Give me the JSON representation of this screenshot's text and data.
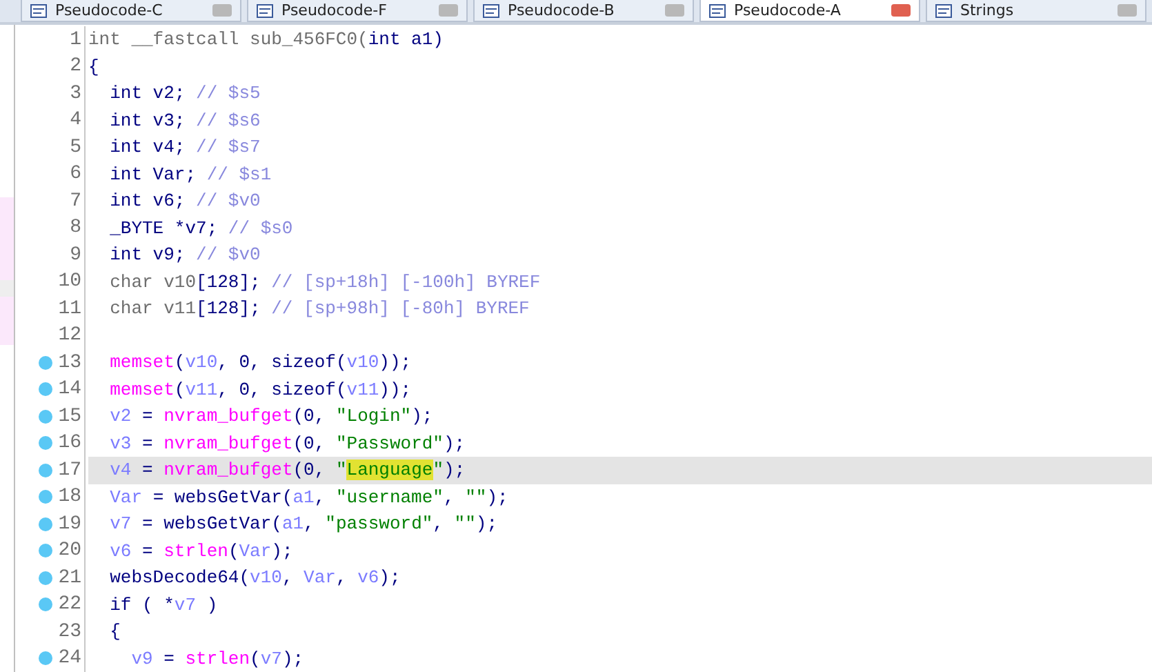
{
  "tabs": [
    {
      "label": "Pseudocode-C",
      "selected": false
    },
    {
      "label": "Pseudocode-F",
      "selected": false
    },
    {
      "label": "Pseudocode-B",
      "selected": false
    },
    {
      "label": "Pseudocode-A",
      "selected": true
    },
    {
      "label": "Strings",
      "selected": false
    }
  ],
  "lines": [
    {
      "number": "1",
      "breakpoint": false,
      "current": false,
      "tokens": [
        {
          "kind": "gray",
          "text": "int __fastcall sub_456FC0("
        },
        {
          "kind": "plain",
          "text": "int a1)"
        }
      ]
    },
    {
      "number": "2",
      "breakpoint": false,
      "current": false,
      "tokens": [
        {
          "kind": "plain",
          "text": "{"
        }
      ]
    },
    {
      "number": "3",
      "breakpoint": false,
      "current": false,
      "tokens": [
        {
          "kind": "plain",
          "text": "  int v2; "
        },
        {
          "kind": "comment",
          "text": "// $s5"
        }
      ]
    },
    {
      "number": "4",
      "breakpoint": false,
      "current": false,
      "tokens": [
        {
          "kind": "plain",
          "text": "  int v3; "
        },
        {
          "kind": "comment",
          "text": "// $s6"
        }
      ]
    },
    {
      "number": "5",
      "breakpoint": false,
      "current": false,
      "tokens": [
        {
          "kind": "plain",
          "text": "  int v4; "
        },
        {
          "kind": "comment",
          "text": "// $s7"
        }
      ]
    },
    {
      "number": "6",
      "breakpoint": false,
      "current": false,
      "tokens": [
        {
          "kind": "plain",
          "text": "  int Var; "
        },
        {
          "kind": "comment",
          "text": "// $s1"
        }
      ]
    },
    {
      "number": "7",
      "breakpoint": false,
      "current": false,
      "tokens": [
        {
          "kind": "plain",
          "text": "  int v6; "
        },
        {
          "kind": "comment",
          "text": "// $v0"
        }
      ]
    },
    {
      "number": "8",
      "breakpoint": false,
      "current": false,
      "tokens": [
        {
          "kind": "plain",
          "text": "  _BYTE *v7; "
        },
        {
          "kind": "comment",
          "text": "// $s0"
        }
      ]
    },
    {
      "number": "9",
      "breakpoint": false,
      "current": false,
      "tokens": [
        {
          "kind": "plain",
          "text": "  int v9; "
        },
        {
          "kind": "comment",
          "text": "// $v0"
        }
      ]
    },
    {
      "number": "10",
      "breakpoint": false,
      "current": false,
      "tokens": [
        {
          "kind": "gray",
          "text": "  char v10"
        },
        {
          "kind": "plain",
          "text": "[128]; "
        },
        {
          "kind": "comment",
          "text": "// [sp+18h] [-100h] BYREF"
        }
      ]
    },
    {
      "number": "11",
      "breakpoint": false,
      "current": false,
      "tokens": [
        {
          "kind": "gray",
          "text": "  char v11"
        },
        {
          "kind": "plain",
          "text": "[128]; "
        },
        {
          "kind": "comment",
          "text": "// [sp+98h] [-80h] BYREF"
        }
      ]
    },
    {
      "number": "12",
      "breakpoint": false,
      "current": false
    },
    {
      "number": "13",
      "breakpoint": true,
      "current": false,
      "tokens": [
        {
          "kind": "import",
          "text": "  memset"
        },
        {
          "kind": "plain",
          "text": "("
        },
        {
          "kind": "var",
          "text": "v10"
        },
        {
          "kind": "plain",
          "text": ", 0, sizeof("
        },
        {
          "kind": "var",
          "text": "v10"
        },
        {
          "kind": "plain",
          "text": "));"
        }
      ]
    },
    {
      "number": "14",
      "breakpoint": true,
      "current": false,
      "tokens": [
        {
          "kind": "import",
          "text": "  memset"
        },
        {
          "kind": "plain",
          "text": "("
        },
        {
          "kind": "var",
          "text": "v11"
        },
        {
          "kind": "plain",
          "text": ", 0, sizeof("
        },
        {
          "kind": "var",
          "text": "v11"
        },
        {
          "kind": "plain",
          "text": "));"
        }
      ]
    },
    {
      "number": "15",
      "breakpoint": true,
      "current": false,
      "tokens": [
        {
          "kind": "var",
          "text": "  v2"
        },
        {
          "kind": "plain",
          "text": " = "
        },
        {
          "kind": "import",
          "text": "nvram_bufget"
        },
        {
          "kind": "plain",
          "text": "(0, "
        },
        {
          "kind": "string",
          "text": "\"Login\""
        },
        {
          "kind": "plain",
          "text": ");"
        }
      ]
    },
    {
      "number": "16",
      "breakpoint": true,
      "current": false,
      "tokens": [
        {
          "kind": "var",
          "text": "  v3"
        },
        {
          "kind": "plain",
          "text": " = "
        },
        {
          "kind": "import",
          "text": "nvram_bufget"
        },
        {
          "kind": "plain",
          "text": "(0, "
        },
        {
          "kind": "string",
          "text": "\"Password\""
        },
        {
          "kind": "plain",
          "text": ");"
        }
      ]
    },
    {
      "number": "17",
      "breakpoint": true,
      "current": true,
      "tokens": [
        {
          "kind": "var",
          "text": "  v4"
        },
        {
          "kind": "plain",
          "text": " = "
        },
        {
          "kind": "import",
          "text": "nvram_bufget"
        },
        {
          "kind": "plain",
          "text": "(0, "
        },
        {
          "kind": "string",
          "text": "\""
        },
        {
          "kind": "hit",
          "text": "Language"
        },
        {
          "kind": "string",
          "text": "\""
        },
        {
          "kind": "plain",
          "text": ");"
        }
      ]
    },
    {
      "number": "18",
      "breakpoint": true,
      "current": false,
      "tokens": [
        {
          "kind": "var",
          "text": "  Var"
        },
        {
          "kind": "plain",
          "text": " = websGetVar("
        },
        {
          "kind": "var",
          "text": "a1"
        },
        {
          "kind": "plain",
          "text": ", "
        },
        {
          "kind": "string",
          "text": "\"username\""
        },
        {
          "kind": "plain",
          "text": ", "
        },
        {
          "kind": "string",
          "text": "\"\""
        },
        {
          "kind": "plain",
          "text": ");"
        }
      ]
    },
    {
      "number": "19",
      "breakpoint": true,
      "current": false,
      "tokens": [
        {
          "kind": "var",
          "text": "  v7"
        },
        {
          "kind": "plain",
          "text": " = websGetVar("
        },
        {
          "kind": "var",
          "text": "a1"
        },
        {
          "kind": "plain",
          "text": ", "
        },
        {
          "kind": "string",
          "text": "\"password\""
        },
        {
          "kind": "plain",
          "text": ", "
        },
        {
          "kind": "string",
          "text": "\"\""
        },
        {
          "kind": "plain",
          "text": ");"
        }
      ]
    },
    {
      "number": "20",
      "breakpoint": true,
      "current": false,
      "tokens": [
        {
          "kind": "var",
          "text": "  v6"
        },
        {
          "kind": "plain",
          "text": " = "
        },
        {
          "kind": "import",
          "text": "strlen"
        },
        {
          "kind": "plain",
          "text": "("
        },
        {
          "kind": "var",
          "text": "Var"
        },
        {
          "kind": "plain",
          "text": ");"
        }
      ]
    },
    {
      "number": "21",
      "breakpoint": true,
      "current": false,
      "tokens": [
        {
          "kind": "plain",
          "text": "  websDecode64("
        },
        {
          "kind": "var",
          "text": "v10"
        },
        {
          "kind": "plain",
          "text": ", "
        },
        {
          "kind": "var",
          "text": "Var"
        },
        {
          "kind": "plain",
          "text": ", "
        },
        {
          "kind": "var",
          "text": "v6"
        },
        {
          "kind": "plain",
          "text": ");"
        }
      ]
    },
    {
      "number": "22",
      "breakpoint": true,
      "current": false,
      "tokens": [
        {
          "kind": "plain",
          "text": "  if ( *"
        },
        {
          "kind": "var",
          "text": "v7"
        },
        {
          "kind": "plain",
          "text": " )"
        }
      ]
    },
    {
      "number": "23",
      "breakpoint": false,
      "current": false,
      "tokens": [
        {
          "kind": "plain",
          "text": "  {"
        }
      ]
    },
    {
      "number": "24",
      "breakpoint": true,
      "current": false,
      "tokens": [
        {
          "kind": "var",
          "text": "    v9"
        },
        {
          "kind": "plain",
          "text": " = "
        },
        {
          "kind": "import",
          "text": "strlen"
        },
        {
          "kind": "plain",
          "text": "("
        },
        {
          "kind": "var",
          "text": "v7"
        },
        {
          "kind": "plain",
          "text": ");"
        }
      ]
    }
  ]
}
